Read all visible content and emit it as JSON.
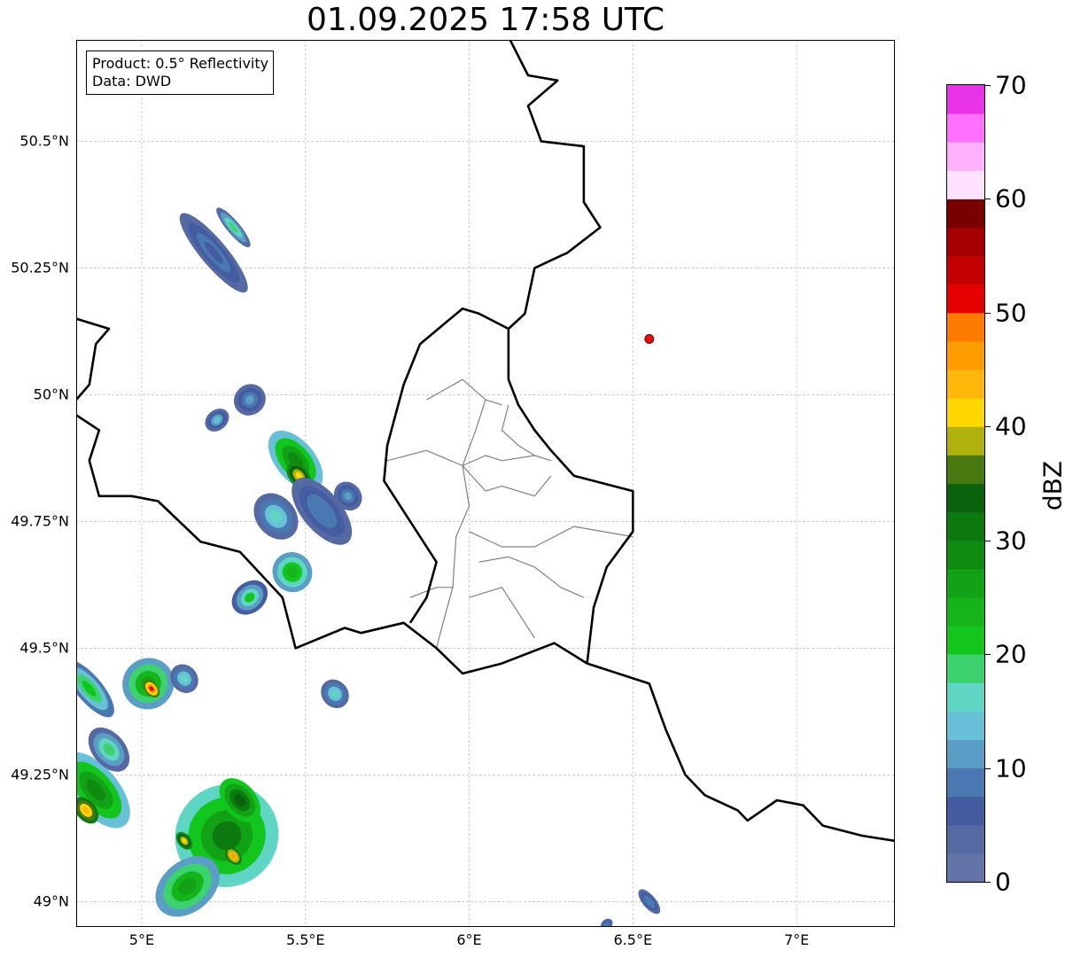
{
  "title": "01.09.2025 17:58 UTC",
  "info_box": {
    "product": "Product: 0.5° Reflectivity",
    "data": "Data: DWD"
  },
  "map_extent": {
    "lon": [
      4.8,
      7.3
    ],
    "lat": [
      48.95,
      50.7
    ]
  },
  "lat_labels": [
    {
      "value": 50.5,
      "text": "50.5°N"
    },
    {
      "value": 50.25,
      "text": "50.25°N"
    },
    {
      "value": 50.0,
      "text": "50°N"
    },
    {
      "value": 49.75,
      "text": "49.75°N"
    },
    {
      "value": 49.5,
      "text": "49.5°N"
    },
    {
      "value": 49.25,
      "text": "49.25°N"
    },
    {
      "value": 49.0,
      "text": "49°N"
    }
  ],
  "lon_labels": [
    {
      "value": 5.0,
      "text": "5°E"
    },
    {
      "value": 5.5,
      "text": "5.5°E"
    },
    {
      "value": 6.0,
      "text": "6°E"
    },
    {
      "value": 6.5,
      "text": "6.5°E"
    },
    {
      "value": 7.0,
      "text": "7°E"
    }
  ],
  "marker": {
    "lon": 6.55,
    "lat": 50.11,
    "color": "#ff0000"
  },
  "colorbar": {
    "label": "dBZ",
    "min": 0,
    "max": 70,
    "ticks": [
      {
        "value": 0,
        "text": "0"
      },
      {
        "value": 10,
        "text": "10"
      },
      {
        "value": 20,
        "text": "20"
      },
      {
        "value": 30,
        "text": "30"
      },
      {
        "value": 40,
        "text": "40"
      },
      {
        "value": 50,
        "text": "50"
      },
      {
        "value": 60,
        "text": "60"
      },
      {
        "value": 70,
        "text": "70"
      }
    ],
    "colors": [
      "#6474a8",
      "#5569a2",
      "#445da0",
      "#4a78b0",
      "#5a9ec6",
      "#68c0d8",
      "#5fd6c4",
      "#3cd36e",
      "#12c61e",
      "#14b41a",
      "#12a216",
      "#0f8c10",
      "#0c7a0e",
      "#0a620c",
      "#4a7810",
      "#afb20c",
      "#ffd700",
      "#ffb70a",
      "#ff9c00",
      "#ff7b00",
      "#e60000",
      "#c40000",
      "#a40000",
      "#7a0000",
      "#ffe2ff",
      "#ffb0ff",
      "#ff70ff",
      "#e833e8"
    ]
  },
  "borders_black": [
    [
      [
        6.125,
        50.7
      ],
      [
        6.18,
        50.63
      ],
      [
        6.27,
        50.62
      ],
      [
        6.18,
        50.57
      ],
      [
        6.22,
        50.5
      ],
      [
        6.35,
        50.49
      ],
      [
        6.35,
        50.38
      ],
      [
        6.4,
        50.33
      ],
      [
        6.3,
        50.28
      ],
      [
        6.2,
        50.25
      ],
      [
        6.17,
        50.16
      ],
      [
        6.12,
        50.13
      ],
      [
        6.12,
        50.03
      ],
      [
        6.15,
        49.98
      ],
      [
        6.2,
        49.93
      ],
      [
        6.25,
        49.89
      ],
      [
        6.32,
        49.84
      ],
      [
        6.5,
        49.81
      ],
      [
        6.5,
        49.73
      ],
      [
        6.42,
        49.66
      ],
      [
        6.38,
        49.58
      ],
      [
        6.36,
        49.47
      ]
    ],
    [
      [
        6.36,
        49.47
      ],
      [
        6.55,
        49.43
      ],
      [
        6.6,
        49.34
      ],
      [
        6.66,
        49.25
      ],
      [
        6.72,
        49.21
      ],
      [
        6.82,
        49.18
      ],
      [
        6.85,
        49.16
      ],
      [
        6.94,
        49.2
      ],
      [
        7.02,
        49.19
      ],
      [
        7.08,
        49.15
      ],
      [
        7.2,
        49.13
      ],
      [
        7.3,
        49.12
      ]
    ],
    [
      [
        6.36,
        49.47
      ],
      [
        6.26,
        49.51
      ],
      [
        6.1,
        49.47
      ],
      [
        5.98,
        49.45
      ],
      [
        5.9,
        49.5
      ],
      [
        5.8,
        49.55
      ],
      [
        5.67,
        49.53
      ],
      [
        5.62,
        49.54
      ],
      [
        5.47,
        49.5
      ],
      [
        5.43,
        49.6
      ],
      [
        5.3,
        49.69
      ],
      [
        5.18,
        49.71
      ],
      [
        5.05,
        49.79
      ],
      [
        4.97,
        49.8
      ],
      [
        4.87,
        49.8
      ],
      [
        4.84,
        49.87
      ],
      [
        4.87,
        49.93
      ],
      [
        4.8,
        49.96
      ]
    ],
    [
      [
        5.82,
        49.55
      ],
      [
        5.87,
        49.6
      ],
      [
        5.9,
        49.67
      ],
      [
        5.82,
        49.75
      ],
      [
        5.74,
        49.83
      ],
      [
        5.75,
        49.9
      ],
      [
        5.8,
        50.02
      ],
      [
        5.85,
        50.1
      ],
      [
        5.98,
        50.17
      ],
      [
        6.03,
        50.16
      ],
      [
        6.12,
        50.13
      ]
    ],
    [
      [
        4.8,
        50.15
      ],
      [
        4.9,
        50.13
      ],
      [
        4.86,
        50.1
      ],
      [
        4.84,
        50.02
      ],
      [
        4.8,
        49.99
      ]
    ]
  ],
  "borders_gray": [
    [
      [
        5.87,
        49.99
      ],
      [
        5.98,
        50.03
      ],
      [
        6.05,
        49.99
      ],
      [
        6.1,
        49.98
      ]
    ],
    [
      [
        5.75,
        49.87
      ],
      [
        5.87,
        49.89
      ],
      [
        5.98,
        49.86
      ],
      [
        6.05,
        49.88
      ],
      [
        6.1,
        49.87
      ],
      [
        6.2,
        49.88
      ],
      [
        6.25,
        49.87
      ]
    ],
    [
      [
        6.05,
        49.99
      ],
      [
        6.02,
        49.93
      ],
      [
        5.98,
        49.86
      ],
      [
        6.0,
        49.78
      ],
      [
        5.96,
        49.72
      ],
      [
        5.95,
        49.62
      ],
      [
        5.92,
        49.55
      ],
      [
        5.9,
        49.5
      ]
    ],
    [
      [
        5.98,
        49.86
      ],
      [
        6.05,
        49.81
      ],
      [
        6.1,
        49.82
      ],
      [
        6.2,
        49.8
      ],
      [
        6.25,
        49.84
      ]
    ],
    [
      [
        6.0,
        49.73
      ],
      [
        6.1,
        49.7
      ],
      [
        6.2,
        49.7
      ],
      [
        6.32,
        49.74
      ],
      [
        6.5,
        49.72
      ]
    ],
    [
      [
        6.03,
        49.67
      ],
      [
        6.12,
        49.68
      ],
      [
        6.2,
        49.66
      ],
      [
        6.28,
        49.62
      ],
      [
        6.35,
        49.6
      ]
    ],
    [
      [
        6.0,
        49.6
      ],
      [
        6.1,
        49.62
      ],
      [
        6.15,
        49.57
      ],
      [
        6.2,
        49.52
      ]
    ],
    [
      [
        5.82,
        49.6
      ],
      [
        5.9,
        49.62
      ],
      [
        5.95,
        49.62
      ]
    ],
    [
      [
        6.12,
        49.98
      ],
      [
        6.1,
        49.93
      ],
      [
        6.15,
        49.9
      ],
      [
        6.2,
        49.88
      ]
    ]
  ],
  "echo_cells": [
    {
      "lon": 5.22,
      "lat": 50.28,
      "rx": 0.04,
      "ry": 0.1,
      "dbz": 6
    },
    {
      "lon": 5.28,
      "lat": 50.33,
      "rx": 0.02,
      "ry": 0.05,
      "dbz": 18
    },
    {
      "lon": 5.33,
      "lat": 49.99,
      "rx": 0.05,
      "ry": 0.03,
      "dbz": 10
    },
    {
      "lon": 5.23,
      "lat": 49.95,
      "rx": 0.04,
      "ry": 0.02,
      "dbz": 14
    },
    {
      "lon": 5.47,
      "lat": 49.87,
      "rx": 0.06,
      "ry": 0.07,
      "dbz": 28
    },
    {
      "lon": 5.48,
      "lat": 49.84,
      "rx": 0.03,
      "ry": 0.03,
      "dbz": 42
    },
    {
      "lon": 5.55,
      "lat": 49.77,
      "rx": 0.06,
      "ry": 0.08,
      "dbz": 8
    },
    {
      "lon": 5.63,
      "lat": 49.8,
      "rx": 0.04,
      "ry": 0.03,
      "dbz": 12
    },
    {
      "lon": 5.41,
      "lat": 49.76,
      "rx": 0.06,
      "ry": 0.05,
      "dbz": 16
    },
    {
      "lon": 5.46,
      "lat": 49.65,
      "rx": 0.06,
      "ry": 0.04,
      "dbz": 24
    },
    {
      "lon": 5.33,
      "lat": 49.6,
      "rx": 0.06,
      "ry": 0.03,
      "dbz": 20
    },
    {
      "lon": 5.02,
      "lat": 49.43,
      "rx": 0.08,
      "ry": 0.05,
      "dbz": 26
    },
    {
      "lon": 5.03,
      "lat": 49.42,
      "rx": 0.02,
      "ry": 0.02,
      "dbz": 50
    },
    {
      "lon": 5.13,
      "lat": 49.44,
      "rx": 0.04,
      "ry": 0.03,
      "dbz": 16
    },
    {
      "lon": 4.84,
      "lat": 49.42,
      "rx": 0.04,
      "ry": 0.07,
      "dbz": 22
    },
    {
      "lon": 4.86,
      "lat": 49.22,
      "rx": 0.07,
      "ry": 0.09,
      "dbz": 28
    },
    {
      "lon": 4.83,
      "lat": 49.18,
      "rx": 0.03,
      "ry": 0.03,
      "dbz": 44
    },
    {
      "lon": 4.9,
      "lat": 49.3,
      "rx": 0.05,
      "ry": 0.05,
      "dbz": 18
    },
    {
      "lon": 5.26,
      "lat": 49.13,
      "rx": 0.16,
      "ry": 0.1,
      "dbz": 30
    },
    {
      "lon": 5.14,
      "lat": 49.03,
      "rx": 0.11,
      "ry": 0.05,
      "dbz": 26
    },
    {
      "lon": 5.3,
      "lat": 49.2,
      "rx": 0.05,
      "ry": 0.05,
      "dbz": 34
    },
    {
      "lon": 5.28,
      "lat": 49.09,
      "rx": 0.02,
      "ry": 0.02,
      "dbz": 46
    },
    {
      "lon": 5.13,
      "lat": 49.12,
      "rx": 0.02,
      "ry": 0.02,
      "dbz": 42
    },
    {
      "lon": 5.59,
      "lat": 49.41,
      "rx": 0.04,
      "ry": 0.03,
      "dbz": 16
    },
    {
      "lon": 6.55,
      "lat": 49.0,
      "rx": 0.02,
      "ry": 0.03,
      "dbz": 8
    },
    {
      "lon": 6.42,
      "lat": 48.955,
      "rx": 0.02,
      "ry": 0.01,
      "dbz": 8
    }
  ]
}
